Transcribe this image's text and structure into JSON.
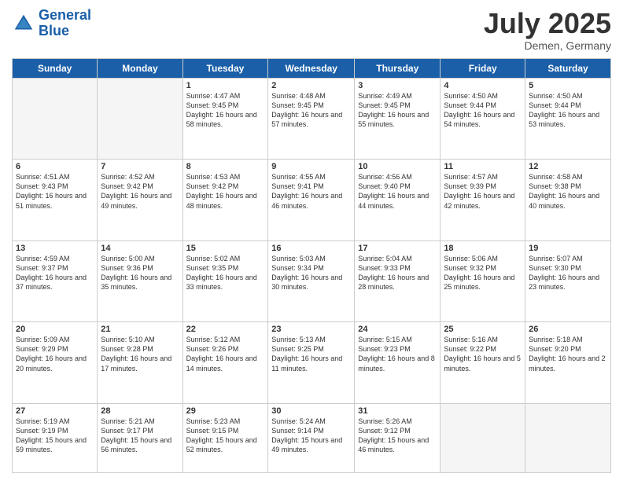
{
  "header": {
    "logo_line1": "General",
    "logo_line2": "Blue",
    "month_year": "July 2025",
    "location": "Demen, Germany"
  },
  "days_of_week": [
    "Sunday",
    "Monday",
    "Tuesday",
    "Wednesday",
    "Thursday",
    "Friday",
    "Saturday"
  ],
  "weeks": [
    [
      {
        "day": "",
        "sunrise": "",
        "sunset": "",
        "daylight": ""
      },
      {
        "day": "",
        "sunrise": "",
        "sunset": "",
        "daylight": ""
      },
      {
        "day": "1",
        "sunrise": "Sunrise: 4:47 AM",
        "sunset": "Sunset: 9:45 PM",
        "daylight": "Daylight: 16 hours and 58 minutes."
      },
      {
        "day": "2",
        "sunrise": "Sunrise: 4:48 AM",
        "sunset": "Sunset: 9:45 PM",
        "daylight": "Daylight: 16 hours and 57 minutes."
      },
      {
        "day": "3",
        "sunrise": "Sunrise: 4:49 AM",
        "sunset": "Sunset: 9:45 PM",
        "daylight": "Daylight: 16 hours and 55 minutes."
      },
      {
        "day": "4",
        "sunrise": "Sunrise: 4:50 AM",
        "sunset": "Sunset: 9:44 PM",
        "daylight": "Daylight: 16 hours and 54 minutes."
      },
      {
        "day": "5",
        "sunrise": "Sunrise: 4:50 AM",
        "sunset": "Sunset: 9:44 PM",
        "daylight": "Daylight: 16 hours and 53 minutes."
      }
    ],
    [
      {
        "day": "6",
        "sunrise": "Sunrise: 4:51 AM",
        "sunset": "Sunset: 9:43 PM",
        "daylight": "Daylight: 16 hours and 51 minutes."
      },
      {
        "day": "7",
        "sunrise": "Sunrise: 4:52 AM",
        "sunset": "Sunset: 9:42 PM",
        "daylight": "Daylight: 16 hours and 49 minutes."
      },
      {
        "day": "8",
        "sunrise": "Sunrise: 4:53 AM",
        "sunset": "Sunset: 9:42 PM",
        "daylight": "Daylight: 16 hours and 48 minutes."
      },
      {
        "day": "9",
        "sunrise": "Sunrise: 4:55 AM",
        "sunset": "Sunset: 9:41 PM",
        "daylight": "Daylight: 16 hours and 46 minutes."
      },
      {
        "day": "10",
        "sunrise": "Sunrise: 4:56 AM",
        "sunset": "Sunset: 9:40 PM",
        "daylight": "Daylight: 16 hours and 44 minutes."
      },
      {
        "day": "11",
        "sunrise": "Sunrise: 4:57 AM",
        "sunset": "Sunset: 9:39 PM",
        "daylight": "Daylight: 16 hours and 42 minutes."
      },
      {
        "day": "12",
        "sunrise": "Sunrise: 4:58 AM",
        "sunset": "Sunset: 9:38 PM",
        "daylight": "Daylight: 16 hours and 40 minutes."
      }
    ],
    [
      {
        "day": "13",
        "sunrise": "Sunrise: 4:59 AM",
        "sunset": "Sunset: 9:37 PM",
        "daylight": "Daylight: 16 hours and 37 minutes."
      },
      {
        "day": "14",
        "sunrise": "Sunrise: 5:00 AM",
        "sunset": "Sunset: 9:36 PM",
        "daylight": "Daylight: 16 hours and 35 minutes."
      },
      {
        "day": "15",
        "sunrise": "Sunrise: 5:02 AM",
        "sunset": "Sunset: 9:35 PM",
        "daylight": "Daylight: 16 hours and 33 minutes."
      },
      {
        "day": "16",
        "sunrise": "Sunrise: 5:03 AM",
        "sunset": "Sunset: 9:34 PM",
        "daylight": "Daylight: 16 hours and 30 minutes."
      },
      {
        "day": "17",
        "sunrise": "Sunrise: 5:04 AM",
        "sunset": "Sunset: 9:33 PM",
        "daylight": "Daylight: 16 hours and 28 minutes."
      },
      {
        "day": "18",
        "sunrise": "Sunrise: 5:06 AM",
        "sunset": "Sunset: 9:32 PM",
        "daylight": "Daylight: 16 hours and 25 minutes."
      },
      {
        "day": "19",
        "sunrise": "Sunrise: 5:07 AM",
        "sunset": "Sunset: 9:30 PM",
        "daylight": "Daylight: 16 hours and 23 minutes."
      }
    ],
    [
      {
        "day": "20",
        "sunrise": "Sunrise: 5:09 AM",
        "sunset": "Sunset: 9:29 PM",
        "daylight": "Daylight: 16 hours and 20 minutes."
      },
      {
        "day": "21",
        "sunrise": "Sunrise: 5:10 AM",
        "sunset": "Sunset: 9:28 PM",
        "daylight": "Daylight: 16 hours and 17 minutes."
      },
      {
        "day": "22",
        "sunrise": "Sunrise: 5:12 AM",
        "sunset": "Sunset: 9:26 PM",
        "daylight": "Daylight: 16 hours and 14 minutes."
      },
      {
        "day": "23",
        "sunrise": "Sunrise: 5:13 AM",
        "sunset": "Sunset: 9:25 PM",
        "daylight": "Daylight: 16 hours and 11 minutes."
      },
      {
        "day": "24",
        "sunrise": "Sunrise: 5:15 AM",
        "sunset": "Sunset: 9:23 PM",
        "daylight": "Daylight: 16 hours and 8 minutes."
      },
      {
        "day": "25",
        "sunrise": "Sunrise: 5:16 AM",
        "sunset": "Sunset: 9:22 PM",
        "daylight": "Daylight: 16 hours and 5 minutes."
      },
      {
        "day": "26",
        "sunrise": "Sunrise: 5:18 AM",
        "sunset": "Sunset: 9:20 PM",
        "daylight": "Daylight: 16 hours and 2 minutes."
      }
    ],
    [
      {
        "day": "27",
        "sunrise": "Sunrise: 5:19 AM",
        "sunset": "Sunset: 9:19 PM",
        "daylight": "Daylight: 15 hours and 59 minutes."
      },
      {
        "day": "28",
        "sunrise": "Sunrise: 5:21 AM",
        "sunset": "Sunset: 9:17 PM",
        "daylight": "Daylight: 15 hours and 56 minutes."
      },
      {
        "day": "29",
        "sunrise": "Sunrise: 5:23 AM",
        "sunset": "Sunset: 9:15 PM",
        "daylight": "Daylight: 15 hours and 52 minutes."
      },
      {
        "day": "30",
        "sunrise": "Sunrise: 5:24 AM",
        "sunset": "Sunset: 9:14 PM",
        "daylight": "Daylight: 15 hours and 49 minutes."
      },
      {
        "day": "31",
        "sunrise": "Sunrise: 5:26 AM",
        "sunset": "Sunset: 9:12 PM",
        "daylight": "Daylight: 15 hours and 46 minutes."
      },
      {
        "day": "",
        "sunrise": "",
        "sunset": "",
        "daylight": ""
      },
      {
        "day": "",
        "sunrise": "",
        "sunset": "",
        "daylight": ""
      }
    ]
  ]
}
